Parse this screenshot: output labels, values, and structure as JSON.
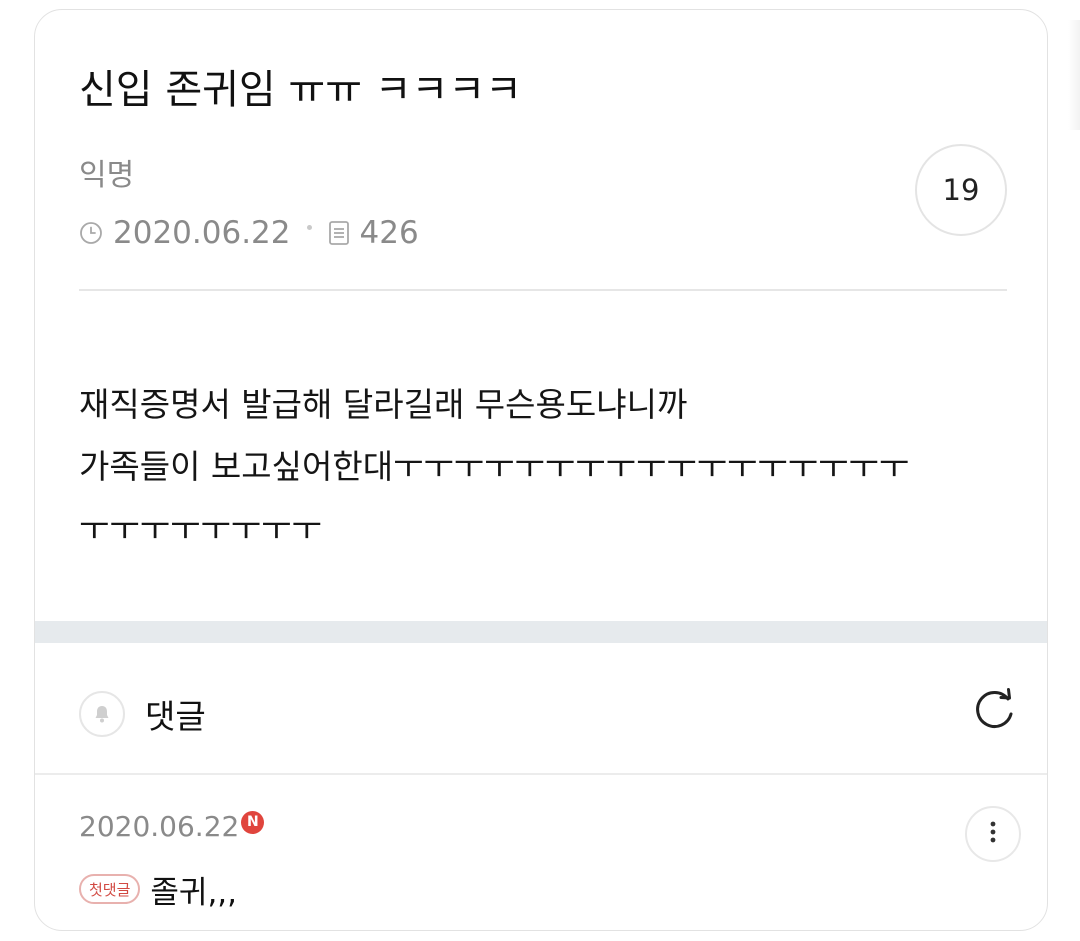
{
  "post": {
    "title": "신입 존귀임 ㅠㅠ ㅋㅋㅋㅋ",
    "author": "익명",
    "date": "2020.06.22",
    "views": "426",
    "comment_count": "19",
    "body_line1": "재직증명서 발급해 달라길래 무슨용도냐니까",
    "body_line2": "가족들이 보고싶어한대ㅜㅜㅜㅜㅜㅜㅜㅜㅜㅜㅜㅜㅜㅜㅜㅜㅜ",
    "body_line3": "ㅜㅜㅜㅜㅜㅜㅜㅜ"
  },
  "comments_section": {
    "label": "댓글"
  },
  "comments": [
    {
      "date": "2020.06.22",
      "new_badge": "N",
      "first_badge": "첫댓글",
      "text": "졸귀,,,"
    }
  ],
  "icons": {
    "clock": "clock-icon",
    "views": "document-icon",
    "bell": "bell-icon",
    "refresh": "refresh-icon",
    "more": "more-vertical-icon"
  },
  "colors": {
    "muted_text": "#8a8a8a",
    "new_badge": "#e0453d",
    "first_comment_badge": "#d24a43",
    "section_band": "#e6eaed"
  }
}
